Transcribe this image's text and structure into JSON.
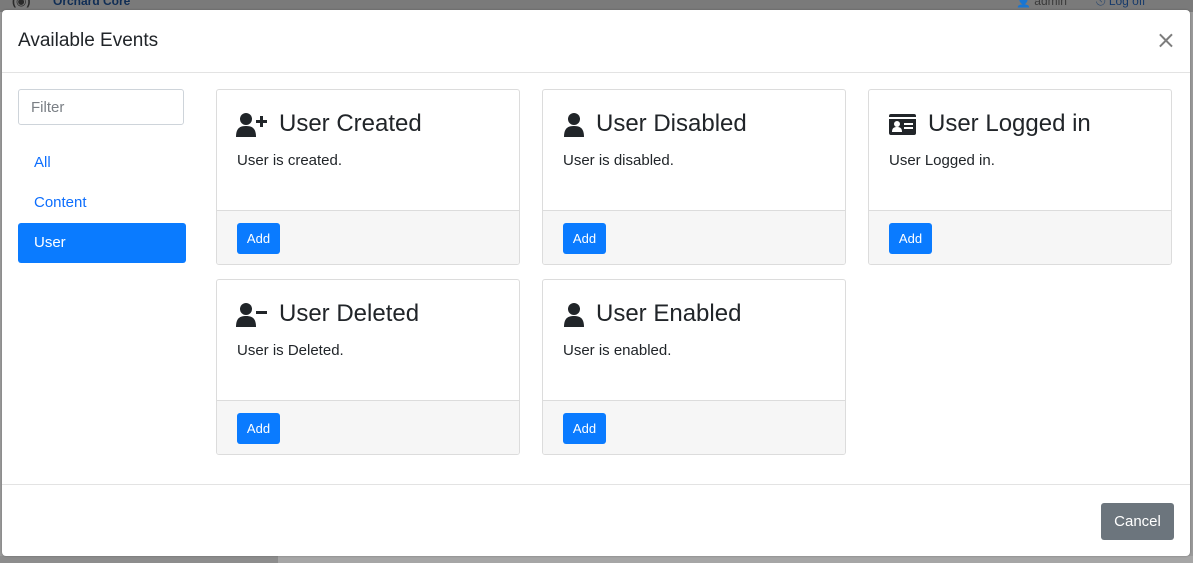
{
  "background": {
    "logo_text": "(◉)",
    "brand": "Orchard Core",
    "user": "admin",
    "logoff": "Log off"
  },
  "modal": {
    "title": "Available Events",
    "close": "×",
    "filter_placeholder": "Filter",
    "categories": [
      "All",
      "Content",
      "User"
    ],
    "active_category": "User",
    "cards": [
      {
        "title": "User Created",
        "description": "User is created.",
        "button": "Add",
        "icon": "user-plus-icon"
      },
      {
        "title": "User Disabled",
        "description": "User is disabled.",
        "button": "Add",
        "icon": "user-icon"
      },
      {
        "title": "User Logged in",
        "description": "User Logged in.",
        "button": "Add",
        "icon": "id-card-icon"
      },
      {
        "title": "User Deleted",
        "description": "User is Deleted.",
        "button": "Add",
        "icon": "user-minus-icon"
      },
      {
        "title": "User Enabled",
        "description": "User is enabled.",
        "button": "Add",
        "icon": "user-icon"
      }
    ],
    "cancel": "Cancel"
  },
  "colors": {
    "primary": "#0a7bff",
    "secondary": "#6c757d",
    "footer_bg": "#f6f6f6"
  }
}
